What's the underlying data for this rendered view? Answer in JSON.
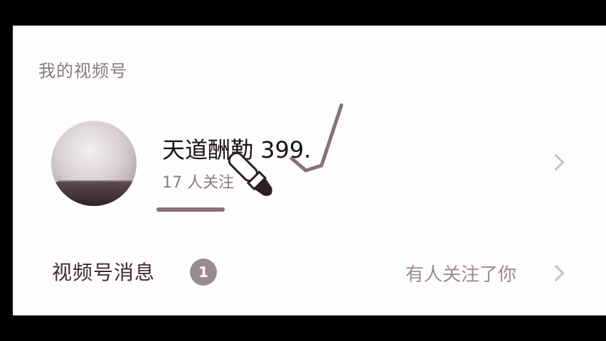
{
  "section": {
    "title": "我的视频号"
  },
  "channel": {
    "name": "天道酬勤 399.",
    "followers": "17 人关注"
  },
  "messages": {
    "label": "视频号消息",
    "badge_count": "1",
    "status": "有人关注了你"
  },
  "icons": {
    "channel_chevron": "chevron-right-icon",
    "messages_chevron": "chevron-right-icon",
    "brush": "brush-icon"
  },
  "colors": {
    "background": "#000000",
    "panel": "#fdfdfd",
    "accent": "#9a8b91",
    "text_primary": "#1a1216",
    "text_secondary": "#8a7b80"
  }
}
